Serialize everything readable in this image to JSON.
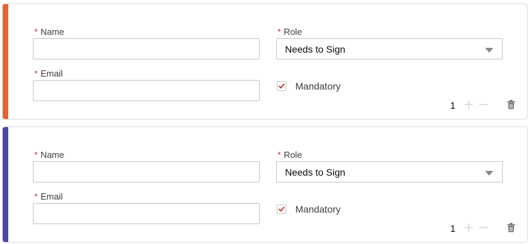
{
  "recipients": [
    {
      "accent_color": "#f0612a",
      "name": {
        "label": "Name",
        "required": "*",
        "value": ""
      },
      "email": {
        "label": "Email",
        "required": "*",
        "value": ""
      },
      "role": {
        "label": "Role",
        "required": "*",
        "selected": "Needs to Sign"
      },
      "mandatory": {
        "label": "Mandatory",
        "checked": true
      },
      "quantity": "1"
    },
    {
      "accent_color": "#4a46b0",
      "name": {
        "label": "Name",
        "required": "*",
        "value": ""
      },
      "email": {
        "label": "Email",
        "required": "*",
        "value": ""
      },
      "role": {
        "label": "Role",
        "required": "*",
        "selected": "Needs to Sign"
      },
      "mandatory": {
        "label": "Mandatory",
        "checked": true
      },
      "quantity": "1"
    }
  ],
  "colors": {
    "required": "#c23934",
    "check": "#c23934",
    "icon": "#b0adab",
    "trash": "#706e6b"
  },
  "icons": [
    "plus-icon",
    "minus-icon",
    "trash-icon",
    "chevron-down-icon",
    "checkmark-icon"
  ]
}
